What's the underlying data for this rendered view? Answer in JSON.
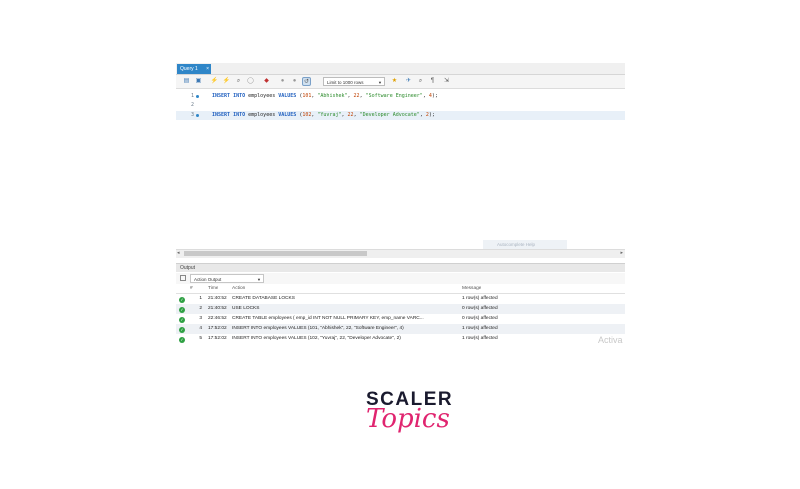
{
  "tab": {
    "label": "Query 1",
    "close": "×"
  },
  "toolbar": {
    "limit_label": "Limit to 1000 rows"
  },
  "editor": {
    "lines": [
      {
        "num": "1",
        "parts": [
          {
            "t": "kw",
            "v": "INSERT INTO"
          },
          {
            "t": "txt",
            "v": " employees "
          },
          {
            "t": "kw",
            "v": "VALUES"
          },
          {
            "t": "txt",
            "v": " ("
          },
          {
            "t": "num",
            "v": "101"
          },
          {
            "t": "txt",
            "v": ", "
          },
          {
            "t": "str",
            "v": "\"Abhishek\""
          },
          {
            "t": "txt",
            "v": ", "
          },
          {
            "t": "num",
            "v": "22"
          },
          {
            "t": "txt",
            "v": ", "
          },
          {
            "t": "str",
            "v": "\"Software Engineer\""
          },
          {
            "t": "txt",
            "v": ", "
          },
          {
            "t": "num",
            "v": "4"
          },
          {
            "t": "txt",
            "v": ");"
          }
        ]
      },
      {
        "num": "2",
        "parts": []
      },
      {
        "num": "3",
        "parts": [
          {
            "t": "kw",
            "v": "INSERT INTO"
          },
          {
            "t": "txt",
            "v": " employees "
          },
          {
            "t": "kw",
            "v": "VALUES"
          },
          {
            "t": "txt",
            "v": " ("
          },
          {
            "t": "num",
            "v": "102"
          },
          {
            "t": "txt",
            "v": ", "
          },
          {
            "t": "str",
            "v": "\"Yuvraj\""
          },
          {
            "t": "txt",
            "v": ", "
          },
          {
            "t": "num",
            "v": "22"
          },
          {
            "t": "txt",
            "v": ", "
          },
          {
            "t": "str",
            "v": "\"Developer Advocate\""
          },
          {
            "t": "txt",
            "v": ", "
          },
          {
            "t": "num",
            "v": "2"
          },
          {
            "t": "txt",
            "v": ");"
          }
        ]
      }
    ]
  },
  "tooltip": "Autocomplete Help",
  "output": {
    "title": "Output",
    "selector": "Action Output",
    "columns": {
      "num": "#",
      "time": "Time",
      "action": "Action",
      "message": "Message"
    },
    "rows": [
      {
        "num": "1",
        "time": "21:40:52",
        "action": "CREATE DATABASE LOCKS",
        "message": "1 row(s) affected"
      },
      {
        "num": "2",
        "time": "21:40:52",
        "action": "USE LOCKS",
        "message": "0 row(s) affected"
      },
      {
        "num": "3",
        "time": "22:46:52",
        "action": "CREATE TABLE employees (    emp_id INT NOT NULL PRIMARY KEY,    emp_name VARC...",
        "message": "0 row(s) affected"
      },
      {
        "num": "4",
        "time": "17:52:02",
        "action": "INSERT INTO employees VALUES (101, \"Abhishek\", 22, \"Software Engineer\", 4)",
        "message": "1 row(s) affected"
      },
      {
        "num": "5",
        "time": "17:52:02",
        "action": "INSERT INTO employees VALUES (102, \"Yuvraj\", 22, \"Developer Advocate\", 2)",
        "message": "1 row(s) affected"
      }
    ]
  },
  "watermark": "Activa",
  "logo": {
    "line1": "SCALER",
    "line2": "Topics"
  }
}
